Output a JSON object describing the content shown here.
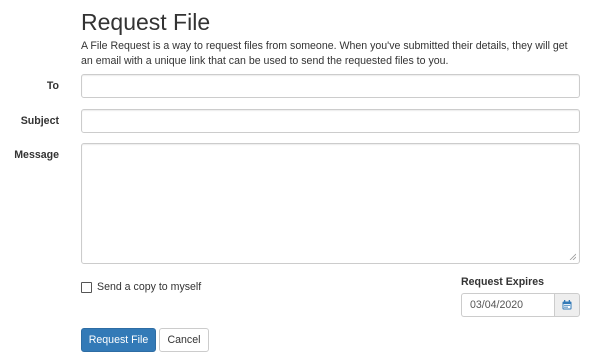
{
  "page": {
    "title": "Request File",
    "description": "A File Request is a way to request files from someone. When you've submitted their details, they will get an email with a unique link that can be used to send the requested files to you."
  },
  "form": {
    "to_label": "To",
    "to_value": "",
    "subject_label": "Subject",
    "subject_value": "",
    "message_label": "Message",
    "message_value": "",
    "copy_label": "Send a copy to myself",
    "copy_checked": false,
    "expires_label": "Request Expires",
    "expires_value": "03/04/2020"
  },
  "icons": {
    "calendar": "calendar-icon",
    "resize": "resize-grip-icon"
  },
  "buttons": {
    "submit_label": "Request File",
    "cancel_label": "Cancel"
  },
  "colors": {
    "primary": "#337ab7",
    "calendar_icon": "#337ab7",
    "border": "#cccccc"
  }
}
